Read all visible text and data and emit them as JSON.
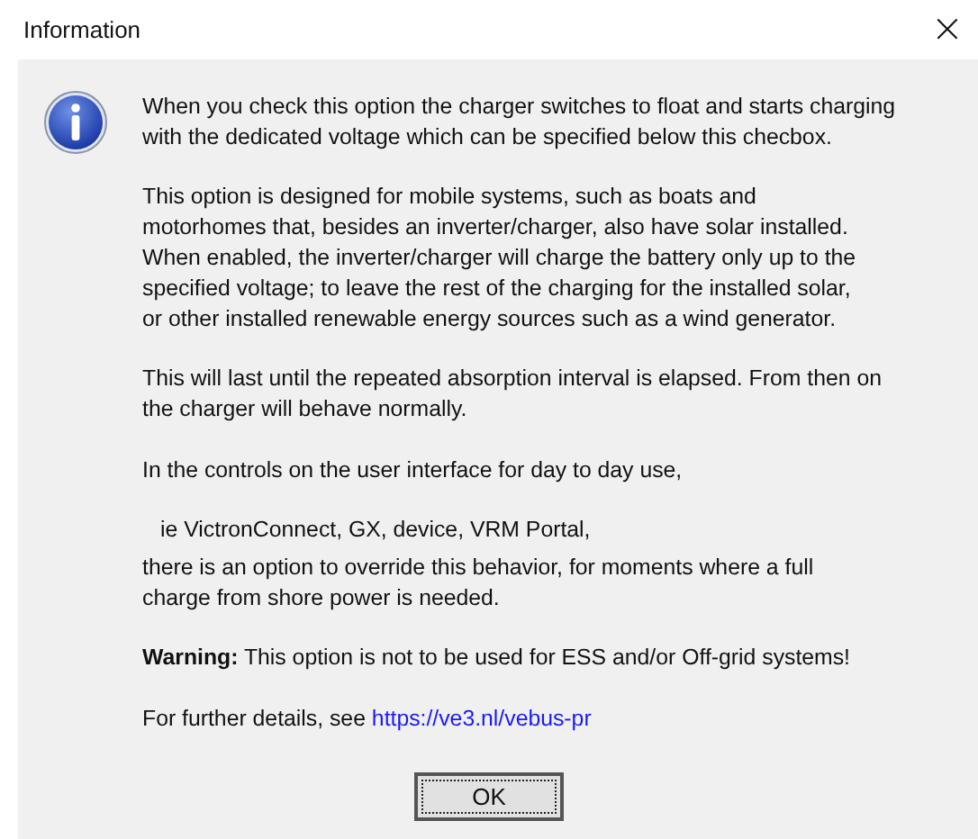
{
  "window": {
    "title": "Information",
    "close": "×"
  },
  "paragraphs": [
    {
      "kind": "text",
      "lines": [
        "When you check this option the charger switches to float and starts charging",
        "with the dedicated voltage which can be specified below this checbox."
      ]
    },
    {
      "kind": "text",
      "lines": [
        "This option is designed for mobile systems, such as boats and",
        "motorhomes that, besides an inverter/charger, also have solar installed.",
        "When enabled, the inverter/charger will charge the battery only up to the",
        "specified voltage; to leave the rest of the charging for the installed solar,",
        "or other installed renewable energy sources such as a wind generator."
      ]
    },
    {
      "kind": "text",
      "lines": [
        "This will last until the repeated absorption interval is elapsed. From then on",
        "the charger will behave normally."
      ]
    },
    {
      "kind": "text",
      "lines": [
        "In the controls on the user interface for day to day use,"
      ]
    },
    {
      "kind": "indent",
      "lines": [
        "ie VictronConnect, GX, device, VRM Portal,"
      ]
    },
    {
      "kind": "tight",
      "lines": [
        "there is an option to override this behavior, for moments where a full",
        "charge from shore power is needed."
      ]
    },
    {
      "kind": "text",
      "lines": [
        "**Warning:** This option is not to be used for ESS and/or Off-grid systems!"
      ]
    },
    {
      "kind": "link",
      "lines": [
        "For further details, see"
      ],
      "link": "https://ve3.nl/vebus-pr"
    }
  ],
  "buttons": [
    {
      "label": "OK",
      "focused": true
    }
  ]
}
